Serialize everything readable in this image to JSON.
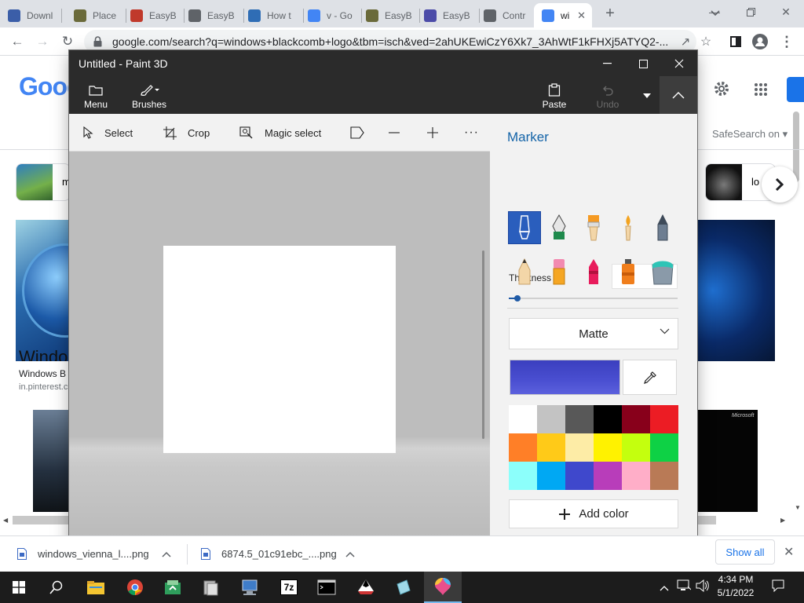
{
  "browser": {
    "tabs": [
      {
        "title": "Downl",
        "favicon": "download-arrow-icon",
        "color": "#3b5ea8"
      },
      {
        "title": "Place",
        "favicon": "easybcd-icon",
        "color": "#6a6a3a"
      },
      {
        "title": "EasyBo",
        "favicon": "tinyurl-icon",
        "color": "#c0392b"
      },
      {
        "title": "EasyB",
        "favicon": "globe-icon",
        "color": "#5f6368"
      },
      {
        "title": "How t",
        "favicon": "howto-icon",
        "color": "#2f6db5"
      },
      {
        "title": "v - Go",
        "favicon": "google-icon",
        "color": "#4285f4"
      },
      {
        "title": "EasyB",
        "favicon": "easybcd-icon",
        "color": "#6a6a3a"
      },
      {
        "title": "EasyB",
        "favicon": "mail-icon",
        "color": "#4b4ba8"
      },
      {
        "title": "Contr",
        "favicon": "globe-icon",
        "color": "#5f6368"
      },
      {
        "title": "wi",
        "favicon": "google-icon",
        "color": "#4285f4",
        "active": true
      }
    ],
    "url": "google.com/search?q=windows+blackcomb+logo&tbm=isch&ved=2ahUKEwiCzY6Xk7_3AhWtF1kFHXj5ATYQ2-..."
  },
  "google": {
    "logo": "Goog",
    "safesearch": "SafeSearch on",
    "chip_text_1": "m",
    "chip_text_2": "lo",
    "result_title": "Windows B",
    "result_source": "in.pinterest.c",
    "thumb_text": "Windo",
    "thumb_brand": "Microsoft"
  },
  "paint3d": {
    "title": "Untitled - Paint 3D",
    "ribbon": {
      "menu": "Menu",
      "brushes": "Brushes",
      "paste": "Paste",
      "undo": "Undo"
    },
    "subtoolbar": {
      "select": "Select",
      "crop": "Crop",
      "magic_select": "Magic select",
      "more": "···"
    },
    "sidebar": {
      "title": "Marker",
      "thickness_label": "Thickness",
      "thickness_value": "5px",
      "thickness_level": 0.05,
      "finish": "Matte",
      "current_color": "#3b3fbf",
      "add_color": "Add color",
      "brushes": [
        {
          "name": "marker-brush-icon",
          "selected": true
        },
        {
          "name": "calligraphy-pen-icon"
        },
        {
          "name": "oil-brush-icon"
        },
        {
          "name": "watercolor-brush-icon"
        },
        {
          "name": "pixel-pen-icon"
        },
        {
          "name": "pencil-icon"
        },
        {
          "name": "eraser-icon"
        },
        {
          "name": "crayon-icon"
        },
        {
          "name": "spray-can-icon"
        },
        {
          "name": "fill-bucket-icon"
        }
      ],
      "palette": [
        "#ffffff",
        "#c3c3c3",
        "#585858",
        "#000000",
        "#88001b",
        "#ec1c24",
        "#ff7f27",
        "#ffca18",
        "#fdeca6",
        "#fff200",
        "#c4ff0e",
        "#0ed145",
        "#8cfffb",
        "#00a8f3",
        "#3f48cc",
        "#b83dba",
        "#ffaec8",
        "#b97a56"
      ]
    }
  },
  "downloads": {
    "items": [
      "windows_vienna_l....png",
      "6874.5_01c91ebc_....png"
    ],
    "show_all": "Show all"
  },
  "taskbar": {
    "time": "4:34 PM",
    "date": "5/1/2022",
    "apps": [
      "search-icon",
      "file-explorer-icon",
      "chrome-icon",
      "app-icon",
      "device-manager-icon",
      "computer-icon",
      "7zip-icon",
      "terminal-icon",
      "inkscape-icon",
      "snip-icon",
      "paint3d-icon"
    ]
  }
}
